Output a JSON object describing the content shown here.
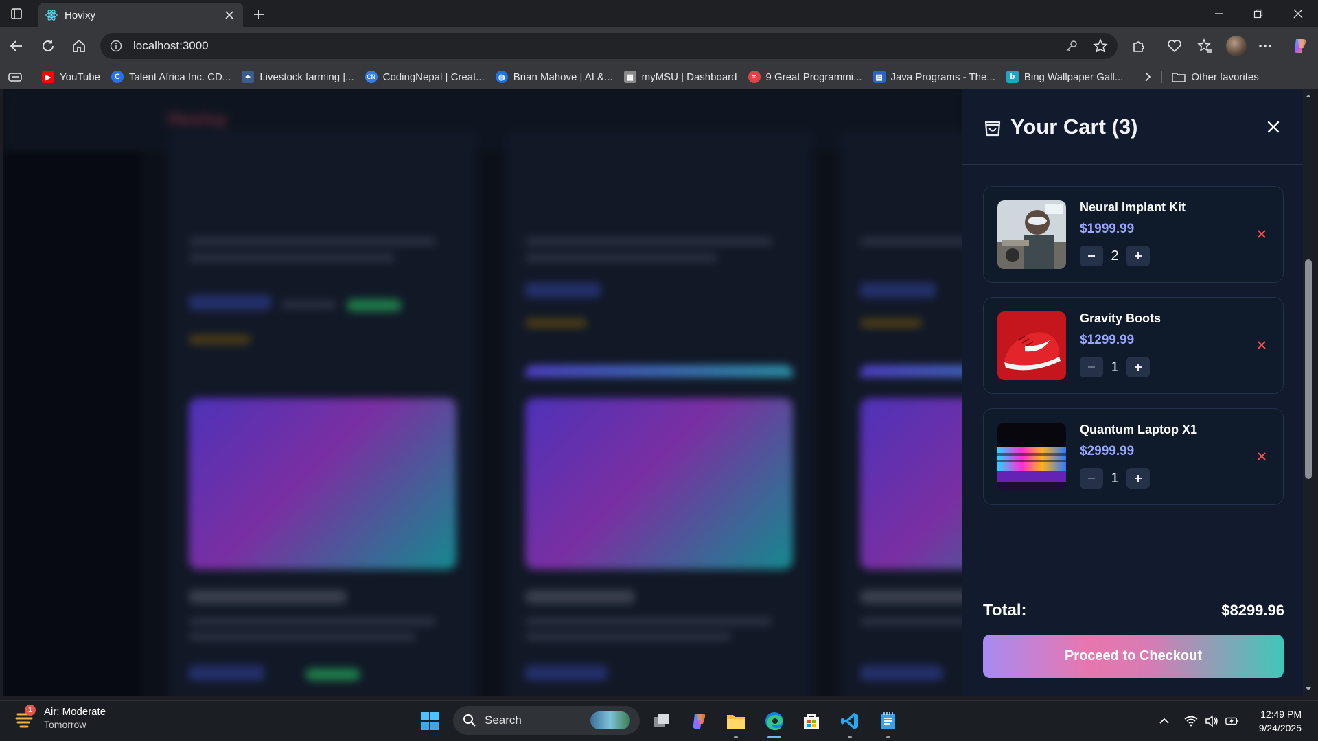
{
  "browser": {
    "tab_title": "Hovixy",
    "url": "localhost:3000",
    "bookmarks": [
      {
        "label": "YouTube",
        "icon": "youtube-icon",
        "color": "#ff0000"
      },
      {
        "label": "Talent Africa Inc. CD...",
        "icon": "talent-africa-icon",
        "color": "#2b6ef5"
      },
      {
        "label": "Livestock farming |...",
        "icon": "livestock-icon",
        "color": "#3b5c8f"
      },
      {
        "label": "CodingNepal | Creat...",
        "icon": "codingnepal-icon",
        "color": "#2f80ed"
      },
      {
        "label": "Brian Mahove | AI &...",
        "icon": "globe-icon",
        "color": "#1a73e8"
      },
      {
        "label": "myMSU | Dashboard",
        "icon": "mymsu-icon",
        "color": "#8a8a8a"
      },
      {
        "label": "9 Great Programmi...",
        "icon": "programming-icon",
        "color": "#e04545"
      },
      {
        "label": "Java Programs - The...",
        "icon": "java-programs-icon",
        "color": "#2a66c9"
      },
      {
        "label": "Bing Wallpaper Gall...",
        "icon": "bing-icon",
        "color": "#1fa3c7"
      }
    ],
    "other_favorites": "Other favorites"
  },
  "page": {
    "logo": "Hovixy"
  },
  "cart": {
    "title": "Your Cart (3)",
    "items": [
      {
        "name": "Neural Implant Kit",
        "price": "$1999.99",
        "qty": "2"
      },
      {
        "name": "Gravity Boots",
        "price": "$1299.99",
        "qty": "1"
      },
      {
        "name": "Quantum Laptop X1",
        "price": "$2999.99",
        "qty": "1"
      }
    ],
    "total_label": "Total:",
    "total_value": "$8299.96",
    "checkout_label": "Proceed to Checkout",
    "colors": {
      "price": "#9aa7ff",
      "remove": "#ff4d4d",
      "panel": "#111b2d"
    }
  },
  "taskbar": {
    "weather_title": "Air: Moderate",
    "weather_sub": "Tomorrow",
    "weather_badge": "1",
    "search_label": "Search",
    "time": "12:49 PM",
    "date": "9/24/2025"
  }
}
